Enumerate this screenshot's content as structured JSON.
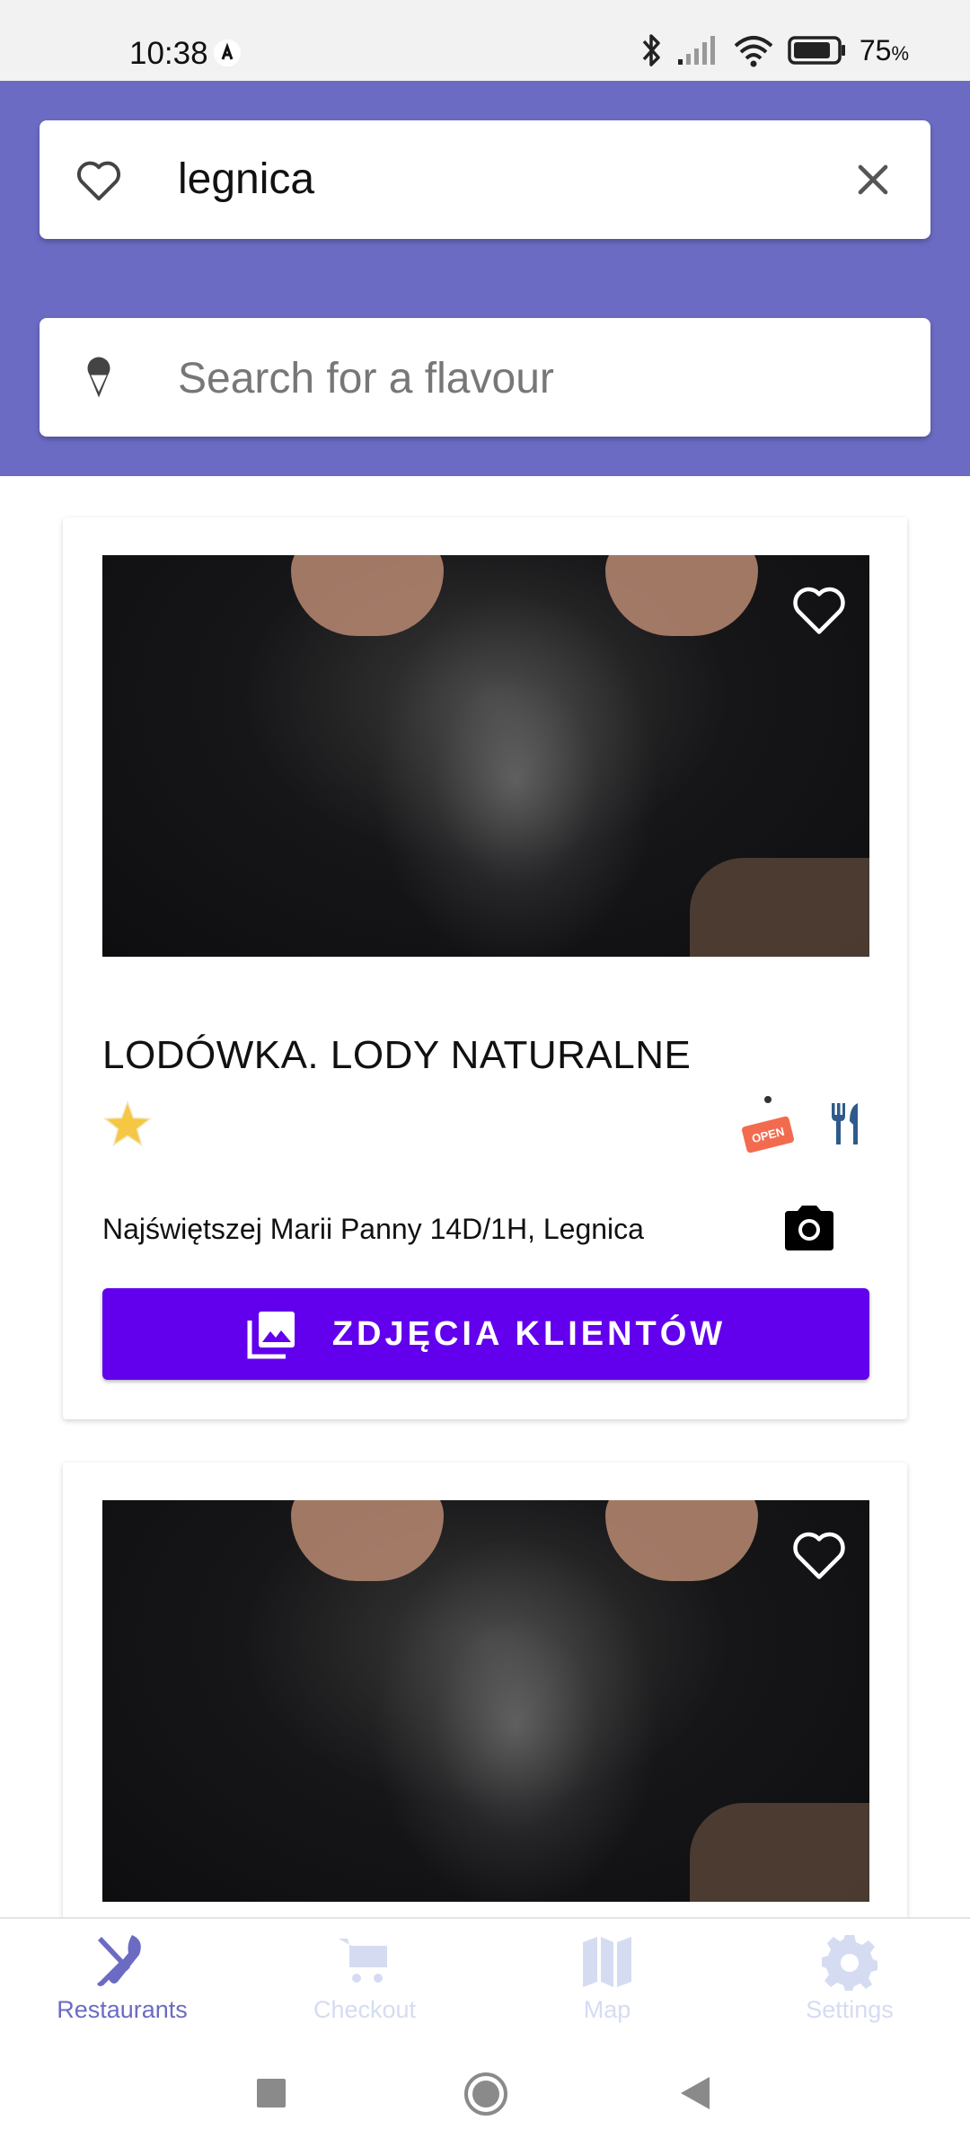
{
  "status_bar": {
    "time": "10:38",
    "battery": "75",
    "battery_unit": "%"
  },
  "search": {
    "city_value": "legnica",
    "flavour_placeholder": "Search for a flavour"
  },
  "cards": [
    {
      "title": "LODÓWKA. LODY NATURALNE",
      "address": "Najświętszej Marii Panny 14D/1H, Legnica",
      "button_label": "ZDJĘCIA KLIENTÓW",
      "open_badge": "OPEN"
    }
  ],
  "bottom_nav": {
    "items": [
      {
        "label": "Restaurants",
        "icon": "cutlery-icon",
        "active": true
      },
      {
        "label": "Checkout",
        "icon": "cart-icon",
        "active": false
      },
      {
        "label": "Map",
        "icon": "map-icon",
        "active": false
      },
      {
        "label": "Settings",
        "icon": "gear-icon",
        "active": false
      }
    ]
  },
  "colors": {
    "header": "#6b6bc4",
    "primary_button": "#6200ee",
    "active_nav": "#6b6bc4",
    "inactive_nav": "#d5dcf2"
  }
}
